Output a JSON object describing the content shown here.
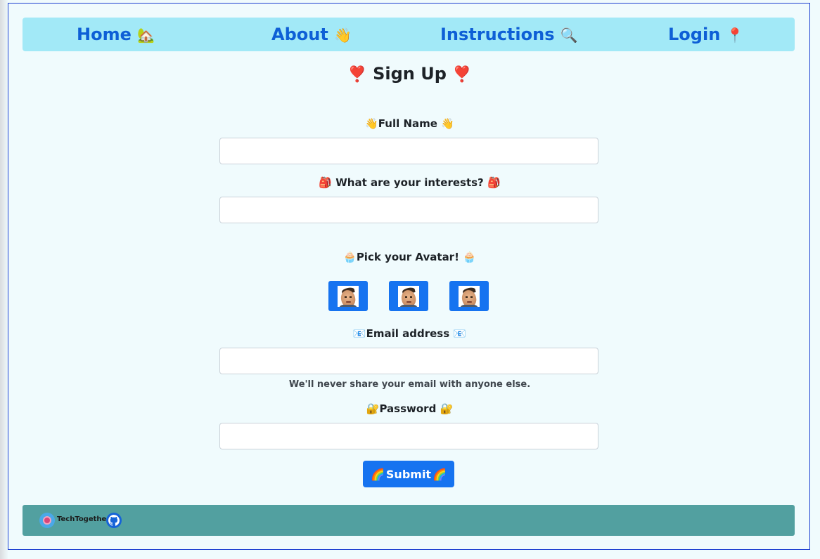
{
  "nav": {
    "home": {
      "label": "Home",
      "emoji": "🏡"
    },
    "about": {
      "label": "About",
      "emoji": "👋"
    },
    "instructions": {
      "label": "Instructions",
      "emoji": "🔍"
    },
    "login": {
      "label": "Login",
      "emoji": "📍"
    }
  },
  "page": {
    "title": "Sign Up",
    "title_emoji": "❣️"
  },
  "form": {
    "full_name": {
      "label": "Full Name",
      "emoji": "👋",
      "value": "",
      "placeholder": ""
    },
    "interests": {
      "label": "What are your interests?",
      "emoji": "🎒",
      "value": "",
      "placeholder": ""
    },
    "avatar": {
      "label": "Pick your Avatar!",
      "emoji": "🧁",
      "options": [
        "avatar-1",
        "avatar-2",
        "avatar-3"
      ]
    },
    "email": {
      "label": "Email address",
      "emoji": "📧",
      "value": "",
      "placeholder": "",
      "help": "We'll never share your email with anyone else."
    },
    "password": {
      "label": "Password",
      "emoji": "🔐",
      "value": "",
      "placeholder": ""
    },
    "submit": {
      "label": "Submit",
      "emoji": "🌈"
    }
  },
  "footer": {
    "brand": "TechTogether",
    "icons": [
      "techtogether-logo-icon",
      "github-icon"
    ]
  },
  "colors": {
    "nav_bg": "#a2e9f7",
    "nav_text": "#0e5fd6",
    "page_bg": "#f0fbfd",
    "button": "#1673f0",
    "footer_bg": "#52a0a0"
  }
}
